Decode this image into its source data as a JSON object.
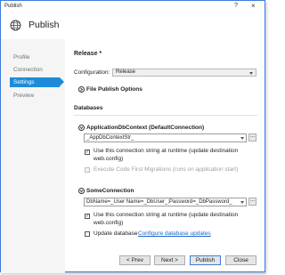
{
  "window": {
    "title": "Publish",
    "help_glyph": "?",
    "close_glyph": "×"
  },
  "header": {
    "title": "Publish",
    "icon": "globe-icon"
  },
  "sidebar": {
    "items": [
      {
        "label": "Profile",
        "active": false
      },
      {
        "label": "Connection",
        "active": false
      },
      {
        "label": "Settings",
        "active": true
      },
      {
        "label": "Preview",
        "active": false
      }
    ]
  },
  "settings": {
    "heading": "Release *",
    "configuration_label": "Configuration:",
    "configuration_value": "Release",
    "file_publish_options": "File Publish Options",
    "databases_heading": "Databases",
    "db1": {
      "name": "ApplicationDbContext (DefaultConnection)",
      "value": "_AppDbContextStr_",
      "use_connection_label": "Use this connection string at runtime (update destination web.config)",
      "use_connection_line1": "Use this connection string at runtime (update destination",
      "use_connection_line2": "web.config)",
      "use_connection_checked": true,
      "code_first_label": "Execute Code First Migrations (runs on application start)",
      "code_first_checked": false,
      "code_first_enabled": false
    },
    "db2": {
      "name": "SomeConnection",
      "value": "DbName=_User Name=_DbUser_;Password=_DbPassword_",
      "use_connection_line1": "Use this connection string at runtime (update destination",
      "use_connection_line2": "web.config)",
      "use_connection_checked": true,
      "update_database_label": "Update database",
      "update_database_checked": false,
      "configure_link": "Configure database updates"
    },
    "ellipsis": "..."
  },
  "footer": {
    "prev": "< Prev",
    "next": "Next >",
    "publish": "Publish",
    "close": "Close"
  },
  "colors": {
    "accent": "#1e8bd9",
    "link": "#1a66c9",
    "border": "#3c7ddb"
  }
}
